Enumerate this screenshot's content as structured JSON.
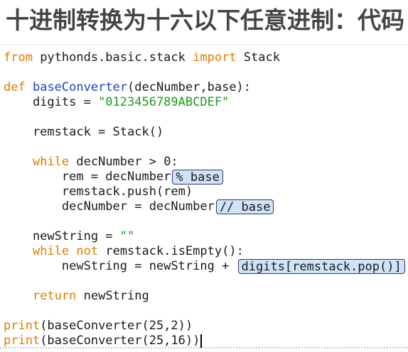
{
  "title": "十进制转换为十六以下任意进制：代码",
  "code": {
    "l1": [
      "from",
      " pythonds.basic.stack ",
      "import",
      " Stack"
    ],
    "l2": [
      "def",
      " ",
      "baseConverter",
      "(decNumber,base):"
    ],
    "l3": [
      "    digits = ",
      "\"0123456789ABCDEF\""
    ],
    "l4": [
      "    remstack = Stack()"
    ],
    "l5": [
      "    ",
      "while",
      " decNumber > 0:"
    ],
    "l6": [
      "        rem = decNumber",
      "% base"
    ],
    "l7": [
      "        remstack.push(rem)"
    ],
    "l8": [
      "        decNumber = decNumber",
      "// base"
    ],
    "l9": [
      "    newString = ",
      "\"\""
    ],
    "l10": [
      "    ",
      "while",
      " ",
      "not",
      " remstack.isEmpty():"
    ],
    "l11": [
      "        newString = newString + ",
      "digits[remstack.pop()]"
    ],
    "l12": [
      "    ",
      "return",
      " newString"
    ],
    "l13": [
      "print",
      "(baseConverter(25,2))"
    ],
    "l14": [
      "print",
      "(baseConverter(25,16))"
    ]
  },
  "colors": {
    "keyword": "#e07b00",
    "function_name": "#1f3fbf",
    "string": "#1f9a1f",
    "highlight_fill": "#cfe2f7",
    "highlight_border": "#2d3a66"
  }
}
